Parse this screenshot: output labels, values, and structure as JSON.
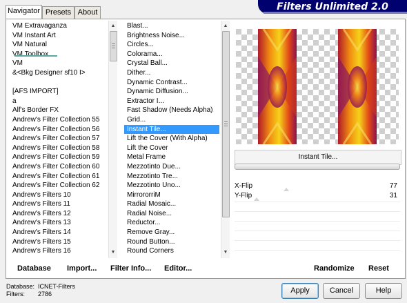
{
  "banner": {
    "title": "Filters Unlimited 2.0"
  },
  "tabs": [
    {
      "label": "Navigator",
      "active": true
    },
    {
      "label": "Presets",
      "active": false
    },
    {
      "label": "About",
      "active": false
    }
  ],
  "categories": [
    "VM Extravaganza",
    "VM Instant Art",
    "VM Natural",
    "VM Toolbox",
    "VM",
    "&<Bkg Designer sf10 I>",
    "",
    "[AFS IMPORT]",
    "a",
    "Alf's Border FX",
    "Andrew's Filter Collection 55",
    "Andrew's Filter Collection 56",
    "Andrew's Filter Collection 57",
    "Andrew's Filter Collection 58",
    "Andrew's Filter Collection 59",
    "Andrew's Filter Collection 60",
    "Andrew's Filter Collection 61",
    "Andrew's Filter Collection 62",
    "Andrew's Filters 10",
    "Andrew's Filters 11",
    "Andrew's Filters 12",
    "Andrew's Filters 13",
    "Andrew's Filters 14",
    "Andrew's Filters 15",
    "Andrew's Filters 16"
  ],
  "filters": [
    "Blast...",
    "Brightness Noise...",
    "Circles...",
    "Colorama...",
    "Crystal Ball...",
    "Dither...",
    "Dynamic Contrast...",
    "Dynamic Diffusion...",
    "Extractor I...",
    "Fast Shadow (Needs Alpha)",
    "Grid...",
    "Instant Tile...",
    "Lift the Cover (With Alpha)",
    "Lift the Cover",
    "Metal Frame",
    "Mezzotinto Due...",
    "Mezzotinto Tre...",
    "Mezzotinto Uno...",
    "MirrororriM",
    "Radial Mosaic...",
    "Radial Noise...",
    "Reductor...",
    "Remove Gray...",
    "Round Button...",
    "Round Corners"
  ],
  "selected_filter": "Instant Tile...",
  "current_filter_label": "Instant Tile...",
  "params": [
    {
      "label": "X-Flip",
      "value": "77",
      "level": 0.3
    },
    {
      "label": "Y-Flip",
      "value": "31",
      "level": 0.12
    }
  ],
  "toolbar": {
    "database": "Database",
    "import": "Import...",
    "filter_info": "Filter Info...",
    "editor": "Editor...",
    "randomize": "Randomize",
    "reset": "Reset"
  },
  "status": {
    "database_label": "Database:",
    "database_value": "ICNET-Filters",
    "filters_label": "Filters:",
    "filters_value": "2786"
  },
  "buttons": {
    "apply": "Apply",
    "cancel": "Cancel",
    "help": "Help"
  },
  "colors": {
    "banner": "#00006e",
    "selection": "#3399ff",
    "underline": "#5aa9a0"
  }
}
